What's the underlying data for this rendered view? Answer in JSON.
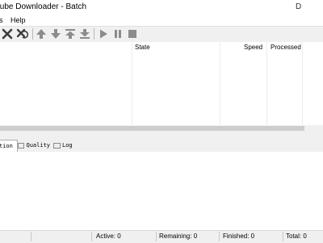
{
  "window": {
    "title": "tube Downloader - Batch",
    "restore_glyph": "D"
  },
  "menu": {
    "items": [
      "s",
      "Help"
    ]
  },
  "toolbar": {
    "buttons": [
      {
        "icon": "delete-x-icon"
      },
      {
        "icon": "delete-all-icon"
      },
      {
        "icon": "move-up-icon"
      },
      {
        "icon": "move-down-icon"
      },
      {
        "icon": "move-top-icon"
      },
      {
        "icon": "move-bottom-icon"
      },
      {
        "icon": "start-icon"
      },
      {
        "icon": "pause-icon"
      },
      {
        "icon": "stop-icon"
      }
    ]
  },
  "list": {
    "columns": [
      "State",
      "Speed",
      "Processed"
    ]
  },
  "tabs": [
    {
      "label": "tion",
      "active": true
    },
    {
      "label": "Quality",
      "active": false
    },
    {
      "label": "Log",
      "active": false
    }
  ],
  "status": {
    "active": "Active: 0",
    "remaining": "Remaining: 0",
    "finished": "Finished: 0",
    "total": "Total: 0"
  },
  "colors": {
    "toolbar_bg": "#f0f0f0",
    "icon_gray": "#8c8c8c",
    "icon_dark": "#3c3c3c",
    "status_bg": "#f0f0f0"
  }
}
